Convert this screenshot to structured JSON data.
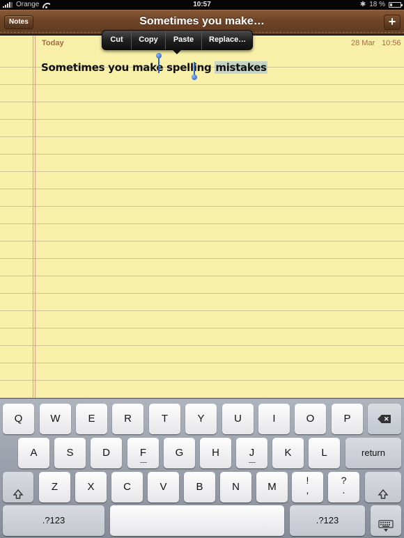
{
  "status_bar": {
    "carrier": "Orange",
    "time": "10:57",
    "battery_percent": "18 %",
    "battery_level": 0.18,
    "icons": [
      "signal-icon",
      "wifi-icon",
      "bluetooth-icon",
      "battery-icon"
    ]
  },
  "header": {
    "back_label": "Notes",
    "title": "Sometimes you make…",
    "add_label": "+"
  },
  "note": {
    "date_label": "Today",
    "date": "28 Mar",
    "time": "10:56",
    "text_before": "Sometimes you make spelling ",
    "text_selected": "mistakes"
  },
  "edit_menu": {
    "items": [
      "Cut",
      "Copy",
      "Paste",
      "Replace…"
    ]
  },
  "keyboard": {
    "row1": [
      "Q",
      "W",
      "E",
      "R",
      "T",
      "Y",
      "U",
      "I",
      "O",
      "P"
    ],
    "row2": [
      "A",
      "S",
      "D",
      "F",
      "G",
      "H",
      "J",
      "K",
      "L"
    ],
    "row3": [
      "Z",
      "X",
      "C",
      "V",
      "B",
      "N",
      "M"
    ],
    "punct1": [
      "!",
      ","
    ],
    "punct2": [
      "?",
      "."
    ],
    "return_label": "return",
    "numbers_label": ".?123",
    "colors": {
      "paper": "#f8f0a8",
      "selection": "#8cb4e6",
      "handle": "#2a66c8"
    }
  }
}
